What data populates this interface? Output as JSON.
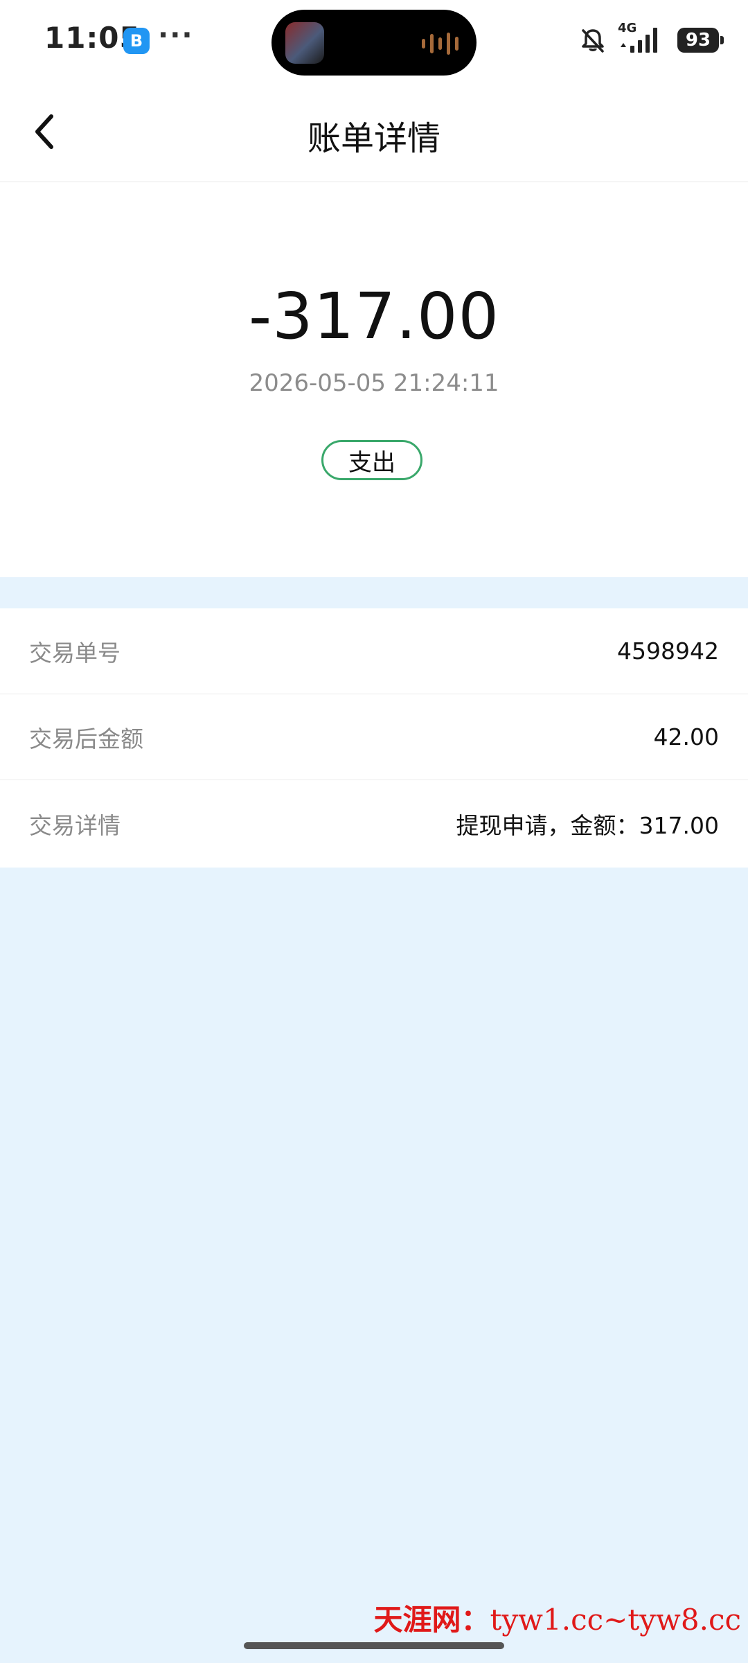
{
  "status_bar": {
    "time": "11:05",
    "app_badge": "B",
    "overflow": "···",
    "network": "4G",
    "battery": "93",
    "icons": [
      "bell-mute-icon",
      "signal-icon",
      "battery-icon"
    ]
  },
  "header": {
    "title": "账单详情",
    "back_icon": "chevron-left-icon"
  },
  "transaction": {
    "amount": "-317.00",
    "datetime": "2026-05-05 21:24:11",
    "type": "支出",
    "type_color": "#3aa86b"
  },
  "details": [
    {
      "label": "交易单号",
      "value": "4598942"
    },
    {
      "label": "交易后金额",
      "value": "42.00"
    },
    {
      "label": "交易详情",
      "value": "提现申请，金额：317.00"
    }
  ],
  "watermark": {
    "cn": "天涯网：",
    "url": "tyw1.cc~tyw8.cc"
  },
  "colors": {
    "page_background": "#e6f3fd",
    "watermark": "#e01919"
  }
}
